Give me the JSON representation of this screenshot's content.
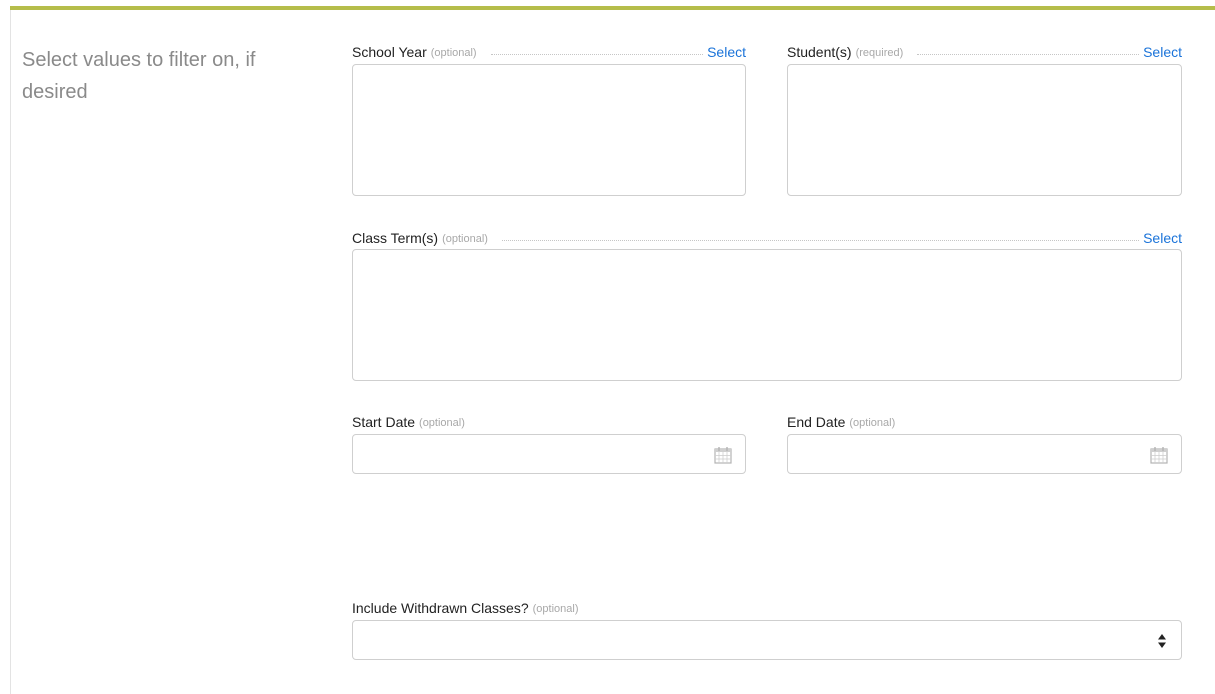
{
  "sidebar": {
    "title": "Select values to filter on, if desired"
  },
  "fields": {
    "school_year": {
      "label": "School Year",
      "hint": "(optional)",
      "action": "Select"
    },
    "students": {
      "label": "Student(s)",
      "hint": "(required)",
      "action": "Select"
    },
    "class_terms": {
      "label": "Class Term(s)",
      "hint": "(optional)",
      "action": "Select"
    },
    "start_date": {
      "label": "Start Date",
      "hint": "(optional)",
      "value": ""
    },
    "end_date": {
      "label": "End Date",
      "hint": "(optional)",
      "value": ""
    },
    "include_withdrawn": {
      "label": "Include Withdrawn Classes?",
      "hint": "(optional)",
      "selected": ""
    }
  },
  "icons": {
    "calendar": "calendar-icon",
    "sort": "sort-arrows-icon"
  },
  "colors": {
    "accent": "#b5bd4a",
    "link": "#1a73d9"
  }
}
